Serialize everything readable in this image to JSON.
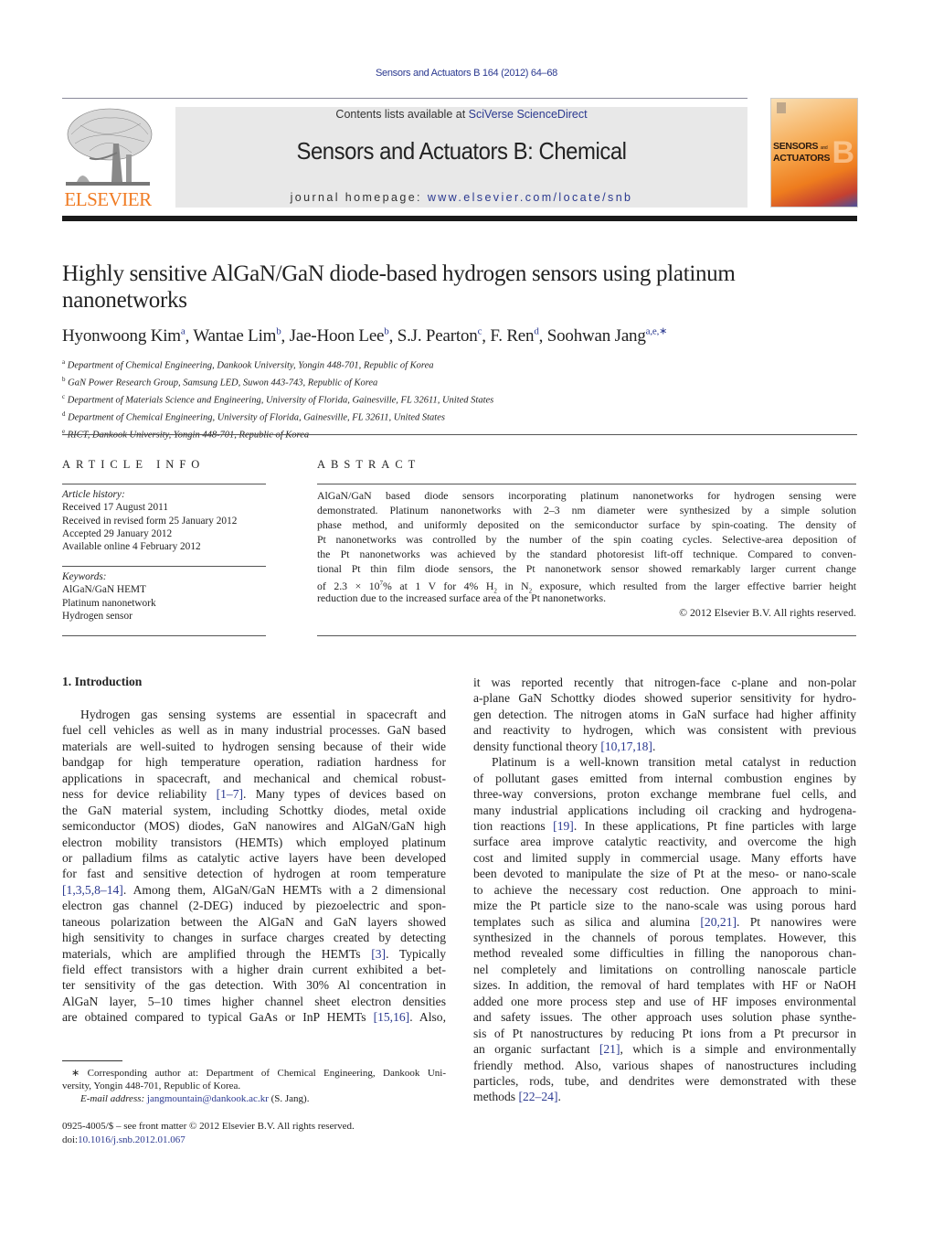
{
  "header": {
    "citation": "Sensors and Actuators B 164 (2012) 64–68",
    "contents_prefix": "Contents lists available at ",
    "contents_link": "SciVerse ScienceDirect",
    "journal_title": "Sensors and Actuators B: Chemical",
    "homepage_prefix": "journal homepage: ",
    "homepage_link": "www.elsevier.com/locate/snb",
    "publisher_logo_text": "ELSEVIER",
    "cover": {
      "line1": "SENSORS",
      "line1_small": "and",
      "line2": "ACTUATORS",
      "letter": "B",
      "colors": {
        "orange": "#f6a54a",
        "deep": "#ee7c1e",
        "blue": "#4b4f9a"
      }
    }
  },
  "article": {
    "title_line1": "Highly sensitive AlGaN/GaN diode-based hydrogen sensors using platinum",
    "title_line2": "nanonetworks",
    "authors": [
      {
        "name": "Hyonwoong Kim",
        "sup": "a"
      },
      {
        "name": "Wantae Lim",
        "sup": "b"
      },
      {
        "name": "Jae-Hoon Lee",
        "sup": "b"
      },
      {
        "name": "S.J. Pearton",
        "sup": "c"
      },
      {
        "name": "F. Ren",
        "sup": "d"
      },
      {
        "name": "Soohwan Jang",
        "sup": "a,e,∗"
      }
    ],
    "affiliations": [
      {
        "sup": "a",
        "text": "Department of Chemical Engineering, Dankook University, Yongin 448-701, Republic of Korea"
      },
      {
        "sup": "b",
        "text": "GaN Power Research Group, Samsung LED, Suwon 443-743, Republic of Korea"
      },
      {
        "sup": "c",
        "text": "Department of Materials Science and Engineering, University of Florida, Gainesville, FL 32611, United States"
      },
      {
        "sup": "d",
        "text": "Department of Chemical Engineering, University of Florida, Gainesville, FL 32611, United States"
      },
      {
        "sup": "e",
        "text": "RICT, Dankook University, Yongin 448-701, Republic of Korea"
      }
    ]
  },
  "article_info": {
    "heading": "ARTICLE INFO",
    "history_label": "Article history:",
    "history": [
      "Received 17 August 2011",
      "Received in revised form 25 January 2012",
      "Accepted 29 January 2012",
      "Available online 4 February 2012"
    ],
    "keywords_label": "Keywords:",
    "keywords": [
      "AlGaN/GaN HEMT",
      "Platinum nanonetwork",
      "Hydrogen sensor"
    ]
  },
  "abstract": {
    "heading": "ABSTRACT",
    "lines": [
      "AlGaN/GaN based diode sensors incorporating platinum nanonetworks for hydrogen sensing were",
      "demonstrated. Platinum nanonetworks with 2–3 nm diameter were synthesized by a simple solution",
      "phase method, and uniformly deposited on the semiconductor surface by spin-coating. The density of",
      "Pt nanonetworks was controlled by the number of the spin coating cycles. Selective-area deposition of",
      "the Pt nanonetworks was achieved by the standard photoresist lift-off technique. Compared to conven-",
      "tional Pt thin film diode sensors, the Pt nanonetwork sensor showed remarkably larger current change"
    ],
    "line7_a": "of 2.3 × 10",
    "line7_sup": "7",
    "line7_b": "% at 1 V for 4% H",
    "line7_sub1": "2",
    "line7_c": " in N",
    "line7_sub2": "2",
    "line7_d": " exposure, which resulted from the larger effective barrier height",
    "line8": "reduction due to the increased surface area of the Pt nanonetworks.",
    "copyright": "© 2012 Elsevier B.V. All rights reserved."
  },
  "introduction": {
    "heading": "1.  Introduction",
    "left_lines": [
      {
        "t": "Hydrogen gas sensing systems are essential in spacecraft and",
        "indent": true
      },
      {
        "t": "fuel cell vehicles as well as in many industrial processes. GaN based"
      },
      {
        "t": "materials are well-suited to hydrogen sensing because of their wide"
      },
      {
        "t": "bandgap for high temperature operation, radiation hardness for"
      },
      {
        "t": "applications in spacecraft, and mechanical and chemical robust-"
      },
      {
        "pre": "ness for device reliability ",
        "ref": "[1–7]",
        "post": ". Many types of devices based on"
      },
      {
        "t": "the GaN material system, including Schottky diodes, metal oxide"
      },
      {
        "t": "semiconductor (MOS) diodes, GaN nanowires and AlGaN/GaN high"
      },
      {
        "t": "electron mobility transistors (HEMTs) which employed platinum"
      },
      {
        "t": "or palladium films as catalytic active layers have been developed"
      },
      {
        "t": "for fast and sensitive detection of hydrogen at room temperature"
      },
      {
        "pre": "",
        "ref": "[1,3,5,8–14]",
        "post": ". Among them, AlGaN/GaN HEMTs with a 2 dimensional"
      },
      {
        "t": "electron gas channel (2-DEG) induced by piezoelectric and spon-"
      },
      {
        "t": "taneous polarization between the AlGaN and GaN layers showed"
      },
      {
        "t": "high sensitivity to changes in surface charges created by detecting"
      },
      {
        "pre": "materials, which are amplified through the HEMTs ",
        "ref": "[3]",
        "post": ". Typically"
      },
      {
        "t": "field effect transistors with a higher drain current exhibited a bet-"
      },
      {
        "t": "ter sensitivity of the gas detection. With 30% Al concentration in"
      },
      {
        "t": "AlGaN layer, 5–10 times higher channel sheet electron densities"
      },
      {
        "pre": "are obtained compared to typical GaAs or InP HEMTs ",
        "ref": "[15,16]",
        "post": ". Also,"
      }
    ],
    "right_lines": [
      {
        "t": "it was reported recently that nitrogen-face c-plane and non-polar"
      },
      {
        "t": "a-plane GaN Schottky diodes showed superior sensitivity for hydro-"
      },
      {
        "t": "gen detection. The nitrogen atoms in GaN surface had higher affinity"
      },
      {
        "t": "and reactivity to hydrogen, which was consistent with previous"
      },
      {
        "pre": "density functional theory ",
        "ref": "[10,17,18]",
        "post": ".",
        "last": true
      },
      {
        "t": "Platinum is a well-known transition metal catalyst in reduction",
        "indent": true
      },
      {
        "t": "of pollutant gases emitted from internal combustion engines by"
      },
      {
        "t": "three-way conversions, proton exchange membrane fuel cells, and"
      },
      {
        "t": "many industrial applications including oil cracking and hydrogena-"
      },
      {
        "pre": "tion reactions ",
        "ref": "[19]",
        "post": ". In these applications, Pt fine particles with large"
      },
      {
        "t": "surface area improve catalytic reactivity, and overcome the high"
      },
      {
        "t": "cost and limited supply in commercial usage. Many efforts have"
      },
      {
        "t": "been devoted to manipulate the size of Pt at the meso- or nano-scale"
      },
      {
        "t": "to achieve the necessary cost reduction. One approach to mini-"
      },
      {
        "t": "mize the Pt particle size to the nano-scale was using porous hard"
      },
      {
        "pre": "templates such as silica and alumina ",
        "ref": "[20,21]",
        "post": ". Pt nanowires were"
      },
      {
        "t": "synthesized in the channels of porous templates. However, this"
      },
      {
        "t": "method revealed some difficulties in filling the nanoporous chan-"
      },
      {
        "t": "nel completely and limitations on controlling nanoscale particle"
      },
      {
        "t": "sizes. In addition, the removal of hard templates with HF or NaOH"
      },
      {
        "t": "added one more process step and use of HF imposes environmental"
      },
      {
        "t": "and safety issues. The other approach uses solution phase synthe-"
      },
      {
        "t": "sis of Pt nanostructures by reducing Pt ions from a Pt precursor in"
      },
      {
        "pre": "an organic surfactant ",
        "ref": "[21]",
        "post": ", which is a simple and environmentally"
      },
      {
        "t": "friendly method. Also, various shapes of nanostructures including"
      },
      {
        "t": "particles, rods, tube, and dendrites were demonstrated with these"
      },
      {
        "pre": "methods ",
        "ref": "[22–24]",
        "post": ".",
        "last": true
      }
    ]
  },
  "footnote": {
    "line1": "∗  Corresponding author at: Department of Chemical Engineering, Dankook Uni-",
    "line2": "versity, Yongin 448-701, Republic of Korea.",
    "email_label": "E-mail address: ",
    "email": "jangmountain@dankook.ac.kr",
    "email_suffix": " (S. Jang)."
  },
  "front_matter": {
    "issn_line": "0925-4005/$ – see front matter © 2012 Elsevier B.V. All rights reserved.",
    "doi_prefix": "doi:",
    "doi": "10.1016/j.snb.2012.01.067"
  },
  "colors": {
    "link": "#2b3990",
    "elsevier_orange": "#f07c24",
    "rule": "#1a1a1a",
    "header_bg": "#e8e8e8"
  }
}
